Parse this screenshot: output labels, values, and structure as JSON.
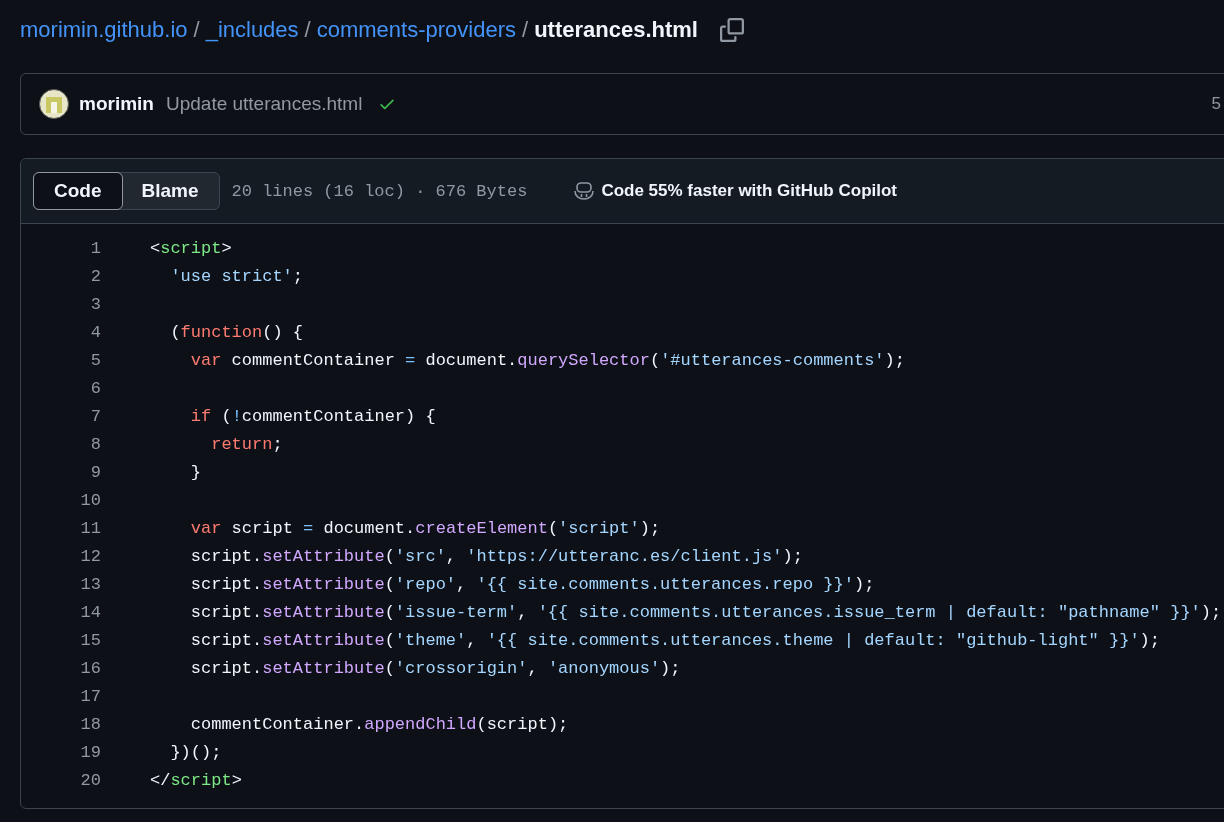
{
  "breadcrumb": {
    "parts": [
      {
        "label": "morimin.github.io",
        "kind": "link"
      },
      {
        "label": "_includes",
        "kind": "link"
      },
      {
        "label": "comments-providers",
        "kind": "link"
      },
      {
        "label": "utterances.html",
        "kind": "current"
      }
    ],
    "separator": "/"
  },
  "commit": {
    "author": "morimin",
    "message": "Update utterances.html",
    "checks_passed": true,
    "trailing": "5"
  },
  "file": {
    "tabs": [
      {
        "label": "Code",
        "selected": true
      },
      {
        "label": "Blame",
        "selected": false
      }
    ],
    "stats": "20 lines (16 loc) · 676 Bytes",
    "copilot": "Code 55% faster with GitHub Copilot",
    "lines": [
      {
        "number": "1",
        "tokens": [
          {
            "text": "<",
            "kind": "plain"
          },
          {
            "text": "script",
            "kind": "tag"
          },
          {
            "text": ">",
            "kind": "plain"
          }
        ]
      },
      {
        "number": "2",
        "tokens": [
          {
            "text": "  'use strict'",
            "kind": "string"
          },
          {
            "text": ";",
            "kind": "plain"
          }
        ]
      },
      {
        "number": "3"
      },
      {
        "number": "4",
        "tokens": [
          {
            "text": "  (",
            "kind": "plain"
          },
          {
            "text": "function",
            "kind": "keyword"
          },
          {
            "text": "() {",
            "kind": "plain"
          }
        ]
      },
      {
        "number": "5",
        "tokens": [
          {
            "text": "    var",
            "kind": "keyword"
          },
          {
            "text": " commentContainer ",
            "kind": "plain"
          },
          {
            "text": "=",
            "kind": "operator"
          },
          {
            "text": " document.",
            "kind": "plain"
          },
          {
            "text": "querySelector",
            "kind": "function"
          },
          {
            "text": "(",
            "kind": "plain"
          },
          {
            "text": "'#utterances-comments'",
            "kind": "string"
          },
          {
            "text": ");",
            "kind": "plain"
          }
        ]
      },
      {
        "number": "6"
      },
      {
        "number": "7",
        "tokens": [
          {
            "text": "    if",
            "kind": "keyword"
          },
          {
            "text": " (",
            "kind": "plain"
          },
          {
            "text": "!",
            "kind": "operator"
          },
          {
            "text": "commentContainer) {",
            "kind": "plain"
          }
        ]
      },
      {
        "number": "8",
        "tokens": [
          {
            "text": "      return",
            "kind": "keyword"
          },
          {
            "text": ";",
            "kind": "plain"
          }
        ]
      },
      {
        "number": "9",
        "tokens": [
          {
            "text": "    }",
            "kind": "plain"
          }
        ]
      },
      {
        "number": "10"
      },
      {
        "number": "11",
        "tokens": [
          {
            "text": "    var",
            "kind": "keyword"
          },
          {
            "text": " script ",
            "kind": "plain"
          },
          {
            "text": "=",
            "kind": "operator"
          },
          {
            "text": " document.",
            "kind": "plain"
          },
          {
            "text": "createElement",
            "kind": "function"
          },
          {
            "text": "(",
            "kind": "plain"
          },
          {
            "text": "'script'",
            "kind": "string"
          },
          {
            "text": ");",
            "kind": "plain"
          }
        ]
      },
      {
        "number": "12",
        "tokens": [
          {
            "text": "    script.",
            "kind": "plain"
          },
          {
            "text": "setAttribute",
            "kind": "function"
          },
          {
            "text": "(",
            "kind": "plain"
          },
          {
            "text": "'src'",
            "kind": "string"
          },
          {
            "text": ", ",
            "kind": "plain"
          },
          {
            "text": "'https://utteranc.es/client.js'",
            "kind": "string"
          },
          {
            "text": ");",
            "kind": "plain"
          }
        ]
      },
      {
        "number": "13",
        "tokens": [
          {
            "text": "    script.",
            "kind": "plain"
          },
          {
            "text": "setAttribute",
            "kind": "function"
          },
          {
            "text": "(",
            "kind": "plain"
          },
          {
            "text": "'repo'",
            "kind": "string"
          },
          {
            "text": ", ",
            "kind": "plain"
          },
          {
            "text": "'{{ site.comments.utterances.repo }}'",
            "kind": "string"
          },
          {
            "text": ");",
            "kind": "plain"
          }
        ]
      },
      {
        "number": "14",
        "tokens": [
          {
            "text": "    script.",
            "kind": "plain"
          },
          {
            "text": "setAttribute",
            "kind": "function"
          },
          {
            "text": "(",
            "kind": "plain"
          },
          {
            "text": "'issue-term'",
            "kind": "string"
          },
          {
            "text": ", ",
            "kind": "plain"
          },
          {
            "text": "'{{ site.comments.utterances.issue_term | default: \"pathname\" }}'",
            "kind": "string"
          },
          {
            "text": ");",
            "kind": "plain"
          }
        ]
      },
      {
        "number": "15",
        "tokens": [
          {
            "text": "    script.",
            "kind": "plain"
          },
          {
            "text": "setAttribute",
            "kind": "function"
          },
          {
            "text": "(",
            "kind": "plain"
          },
          {
            "text": "'theme'",
            "kind": "string"
          },
          {
            "text": ", ",
            "kind": "plain"
          },
          {
            "text": "'{{ site.comments.utterances.theme | default: \"github-light\" }}'",
            "kind": "string"
          },
          {
            "text": ");",
            "kind": "plain"
          }
        ]
      },
      {
        "number": "16",
        "tokens": [
          {
            "text": "    script.",
            "kind": "plain"
          },
          {
            "text": "setAttribute",
            "kind": "function"
          },
          {
            "text": "(",
            "kind": "plain"
          },
          {
            "text": "'crossorigin'",
            "kind": "string"
          },
          {
            "text": ", ",
            "kind": "plain"
          },
          {
            "text": "'anonymous'",
            "kind": "string"
          },
          {
            "text": ");",
            "kind": "plain"
          }
        ]
      },
      {
        "number": "17"
      },
      {
        "number": "18",
        "tokens": [
          {
            "text": "    commentContainer.",
            "kind": "plain"
          },
          {
            "text": "appendChild",
            "kind": "function"
          },
          {
            "text": "(script);",
            "kind": "plain"
          }
        ]
      },
      {
        "number": "19",
        "tokens": [
          {
            "text": "  })();",
            "kind": "plain"
          }
        ]
      },
      {
        "number": "20",
        "tokens": [
          {
            "text": "</",
            "kind": "plain"
          },
          {
            "text": "script",
            "kind": "tag"
          },
          {
            "text": ">",
            "kind": "plain"
          }
        ]
      }
    ]
  }
}
